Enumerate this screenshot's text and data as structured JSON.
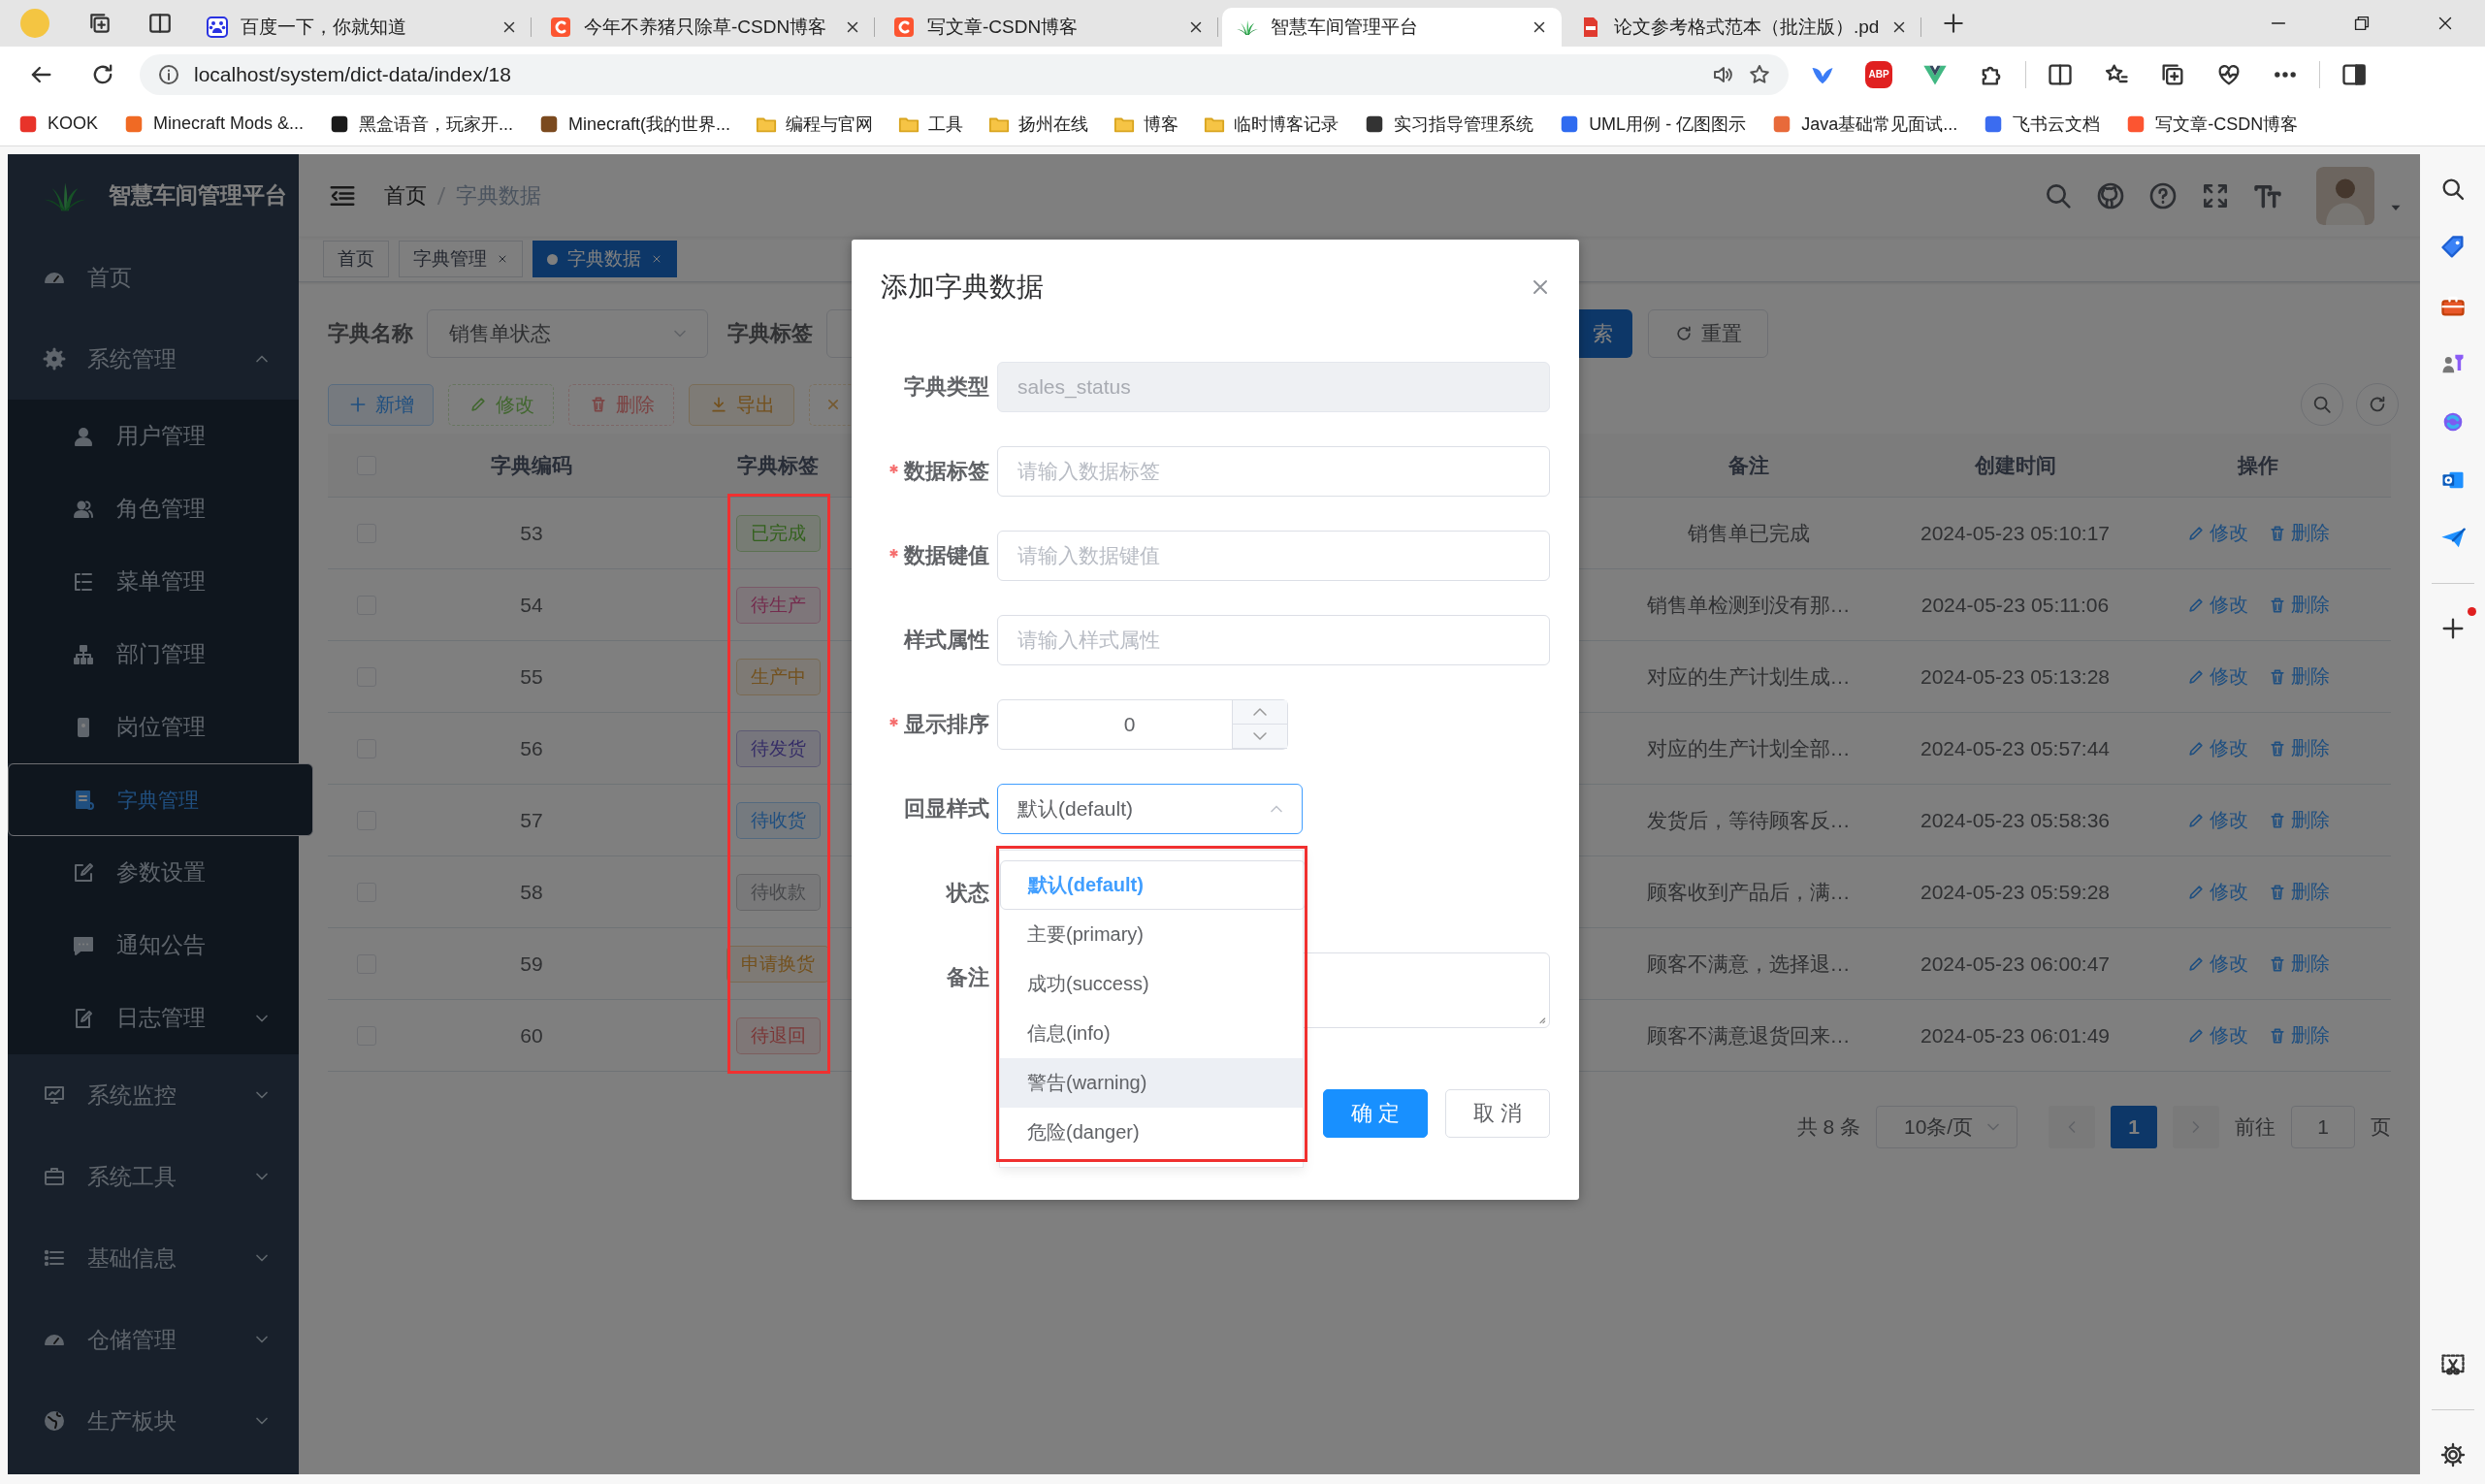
{
  "browser": {
    "tabs": [
      {
        "title": "百度一下，你就知道",
        "selected": false
      },
      {
        "title": "今年不养猪只除草-CSDN博客",
        "selected": false
      },
      {
        "title": "写文章-CSDN博客",
        "selected": false
      },
      {
        "title": "智慧车间管理平台",
        "selected": true
      },
      {
        "title": "论文参考格式范本（批注版）.pd",
        "selected": false
      }
    ],
    "address": "localhost/system/dict-data/index/18",
    "extension_badge": "ABP",
    "bookmarks": [
      {
        "label": "KOOK",
        "kind": "page"
      },
      {
        "label": "Minecraft Mods &...",
        "kind": "page"
      },
      {
        "label": "黑盒语音，玩家开...",
        "kind": "page"
      },
      {
        "label": "Minecraft(我的世界...",
        "kind": "page"
      },
      {
        "label": "编程与官网",
        "kind": "folder"
      },
      {
        "label": "工具",
        "kind": "folder"
      },
      {
        "label": "扬州在线",
        "kind": "folder"
      },
      {
        "label": "博客",
        "kind": "folder"
      },
      {
        "label": "临时博客记录",
        "kind": "folder"
      },
      {
        "label": "实习指导管理系统",
        "kind": "page"
      },
      {
        "label": "UML用例 - 亿图图示",
        "kind": "page"
      },
      {
        "label": "Java基础常见面试...",
        "kind": "page"
      },
      {
        "label": "飞书云文档",
        "kind": "page"
      },
      {
        "label": "写文章-CSDN博客",
        "kind": "page"
      }
    ]
  },
  "app": {
    "title": "智慧车间管理平台",
    "sidebar": [
      {
        "label": "首页",
        "kind": "link",
        "selected": false
      },
      {
        "label": "系统管理",
        "kind": "group",
        "expanded": true,
        "selected": false,
        "children": [
          {
            "label": "用户管理",
            "kind": "link",
            "selected": false
          },
          {
            "label": "角色管理",
            "kind": "link",
            "selected": false
          },
          {
            "label": "菜单管理",
            "kind": "link",
            "selected": false
          },
          {
            "label": "部门管理",
            "kind": "link",
            "selected": false
          },
          {
            "label": "岗位管理",
            "kind": "link",
            "selected": false
          },
          {
            "label": "字典管理",
            "kind": "link",
            "selected": true
          },
          {
            "label": "参数设置",
            "kind": "link",
            "selected": false
          },
          {
            "label": "通知公告",
            "kind": "link",
            "selected": false
          },
          {
            "label": "日志管理",
            "kind": "group",
            "expanded": false,
            "selected": false
          }
        ]
      },
      {
        "label": "系统监控",
        "kind": "group",
        "expanded": false,
        "selected": false
      },
      {
        "label": "系统工具",
        "kind": "group",
        "expanded": false,
        "selected": false
      },
      {
        "label": "基础信息",
        "kind": "group",
        "expanded": false,
        "selected": false
      },
      {
        "label": "仓储管理",
        "kind": "group",
        "expanded": false,
        "selected": false
      },
      {
        "label": "生产板块",
        "kind": "group",
        "expanded": false,
        "selected": false
      }
    ],
    "breadcrumb": [
      "首页",
      "字典数据"
    ],
    "tags": [
      {
        "label": "首页",
        "selected": false,
        "closable": false
      },
      {
        "label": "字典管理",
        "selected": false,
        "closable": true
      },
      {
        "label": "字典数据",
        "selected": true,
        "closable": true
      }
    ],
    "search": {
      "fields": [
        {
          "label": "字典名称",
          "value": "销售单状态"
        },
        {
          "label": "字典标签"
        }
      ],
      "search_button": "索",
      "reset_button": "重置"
    },
    "toolbar": [
      {
        "label": "新增",
        "kind": "primary",
        "disabled": false
      },
      {
        "label": "修改",
        "kind": "success",
        "disabled": true
      },
      {
        "label": "删除",
        "kind": "danger",
        "disabled": true
      },
      {
        "label": "导出",
        "kind": "warning",
        "disabled": false
      }
    ],
    "table": {
      "columns": [
        "字典编码",
        "字典标签",
        "备注",
        "创建时间",
        "操作"
      ],
      "all_checked": false,
      "rows": [
        {
          "checked": false,
          "code": "53",
          "tag": "已完成",
          "kind": "success",
          "remark": "销售单已完成",
          "created": "2024-05-23 05:10:17",
          "actions": [
            "修改",
            "删除"
          ]
        },
        {
          "checked": false,
          "code": "54",
          "tag": "待生产",
          "kind": "pink",
          "remark": "销售单检测到没有那…",
          "created": "2024-05-23 05:11:06",
          "actions": [
            "修改",
            "删除"
          ]
        },
        {
          "checked": false,
          "code": "55",
          "tag": "生产中",
          "kind": "warning",
          "remark": "对应的生产计划生成…",
          "created": "2024-05-23 05:13:28",
          "actions": [
            "修改",
            "删除"
          ]
        },
        {
          "checked": false,
          "code": "56",
          "tag": "待发货",
          "kind": "purple",
          "remark": "对应的生产计划全部…",
          "created": "2024-05-23 05:57:44",
          "actions": [
            "修改",
            "删除"
          ]
        },
        {
          "checked": false,
          "code": "57",
          "tag": "待收货",
          "kind": "primary",
          "remark": "发货后，等待顾客反…",
          "created": "2024-05-23 05:58:36",
          "actions": [
            "修改",
            "删除"
          ]
        },
        {
          "checked": false,
          "code": "58",
          "tag": "待收款",
          "kind": "info",
          "remark": "顾客收到产品后，满…",
          "created": "2024-05-23 05:59:28",
          "actions": [
            "修改",
            "删除"
          ]
        },
        {
          "checked": false,
          "code": "59",
          "tag": "申请换货",
          "kind": "warning",
          "remark": "顾客不满意，选择退…",
          "created": "2024-05-23 06:00:47",
          "actions": [
            "修改",
            "删除"
          ]
        },
        {
          "checked": false,
          "code": "60",
          "tag": "待退回",
          "kind": "danger",
          "remark": "顾客不满意退货回来…",
          "created": "2024-05-23 06:01:49",
          "actions": [
            "修改",
            "删除"
          ]
        }
      ]
    },
    "pagination": {
      "total": "共 8 条",
      "page_size": "10条/页",
      "pages": [
        {
          "label": "1",
          "selected": true
        }
      ],
      "jump_label": "前往",
      "jump_value": "1",
      "page_suffix": "页"
    }
  },
  "dialog": {
    "title": "添加字典数据",
    "fields": [
      {
        "label": "字典类型",
        "kind": "text",
        "value": "sales_status",
        "disabled": true,
        "required": false
      },
      {
        "label": "数据标签",
        "kind": "text",
        "placeholder": "请输入数据标签",
        "disabled": false,
        "required": true
      },
      {
        "label": "数据键值",
        "kind": "text",
        "placeholder": "请输入数据键值",
        "disabled": false,
        "required": true
      },
      {
        "label": "样式属性",
        "kind": "text",
        "placeholder": "请输入样式属性",
        "disabled": false,
        "required": false
      },
      {
        "label": "显示排序",
        "kind": "number",
        "value": "0",
        "required": true
      },
      {
        "label": "回显样式",
        "kind": "select",
        "value": "默认(default)",
        "expanded": true,
        "required": false,
        "options": [
          {
            "label": "默认(default)",
            "selected": true,
            "highlighted": false
          },
          {
            "label": "主要(primary)",
            "selected": false,
            "highlighted": false
          },
          {
            "label": "成功(success)",
            "selected": false,
            "highlighted": false
          },
          {
            "label": "信息(info)",
            "selected": false,
            "highlighted": false
          },
          {
            "label": "警告(warning)",
            "selected": false,
            "highlighted": true
          },
          {
            "label": "危险(danger)",
            "selected": false,
            "highlighted": false
          }
        ]
      },
      {
        "label": "状态",
        "kind": "radio",
        "required": false
      },
      {
        "label": "备注",
        "kind": "textarea",
        "required": false
      }
    ],
    "buttons": [
      {
        "label": "确 定",
        "kind": "primary"
      },
      {
        "label": "取 消",
        "kind": "default"
      }
    ]
  }
}
